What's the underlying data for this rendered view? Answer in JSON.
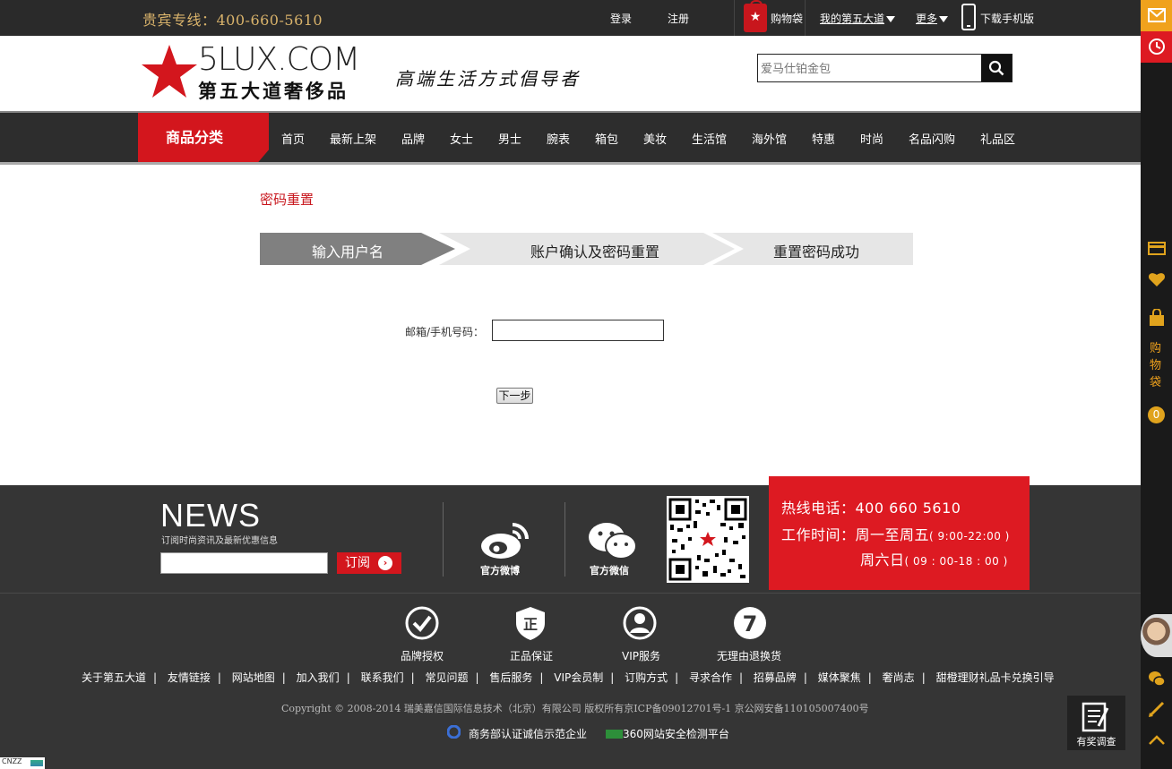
{
  "topbar": {
    "hotline": "贵宾专线：400-660-5610",
    "login": "登录",
    "register": "注册",
    "cart": "购物袋",
    "my_account": "我的第五大道",
    "more": "更多",
    "mobile": "下载手机版"
  },
  "header": {
    "logo_en": "5LUX.COM",
    "logo_cn": "第五大道奢侈品",
    "slogan": "高端生活方式倡导者",
    "search_placeholder": "爱马仕铂金包"
  },
  "nav": {
    "category": "商品分类",
    "items": [
      "首页",
      "最新上架",
      "品牌",
      "女士",
      "男士",
      "腕表",
      "箱包",
      "美妆",
      "生活馆",
      "海外馆",
      "特惠",
      "时尚",
      "名品闪购",
      "礼品区"
    ]
  },
  "main": {
    "title": "密码重置",
    "steps": [
      "输入用户名",
      "账户确认及密码重置",
      "重置密码成功"
    ],
    "active_step": 0,
    "field_label": "邮箱/手机号码：",
    "next_button": "下一步"
  },
  "footer": {
    "news_title": "NEWS",
    "news_sub": "订阅时尚资讯及最新优惠信息",
    "subscribe": "订阅",
    "weibo": "官方微博",
    "wechat": "官方微信",
    "hotline_label": "热线电话：400 660 5610",
    "worktime_label": "工作时间：周一至周五",
    "worktime_hours": "( 9:00-22:00 )",
    "weekend_label": "周六日",
    "weekend_hours": "( 09 : 00-18 : 00 )",
    "services": [
      "品牌授权",
      "正品保证",
      "VIP服务",
      "无理由退换货"
    ],
    "links": [
      "关于第五大道",
      "友情链接",
      "网站地图",
      "加入我们",
      "联系我们",
      "常见问题",
      "售后服务",
      "VIP会员制",
      "订购方式",
      "寻求合作",
      "招募品牌",
      "媒体聚焦",
      "奢尚志",
      "甜橙理财礼品卡兑换引导"
    ],
    "copyright": "Copyright © 2008-2014 瑞美嘉信国际信息技术（北京）有限公司   版权所有京ICP备09012701号-1   京公网安备110105007400号",
    "cert1": "商务部认证诚信示范企业",
    "cert2": "360网站安全检测平台",
    "cnzz": "CNZZ"
  },
  "sidebar": {
    "cart_text": "购物袋",
    "cart_count": "0",
    "survey": "有奖调查"
  },
  "colors": {
    "brand_red": "#d3161d",
    "gold": "#d9b36b",
    "dark": "#2d2d2d",
    "orange": "#f0a21d"
  }
}
